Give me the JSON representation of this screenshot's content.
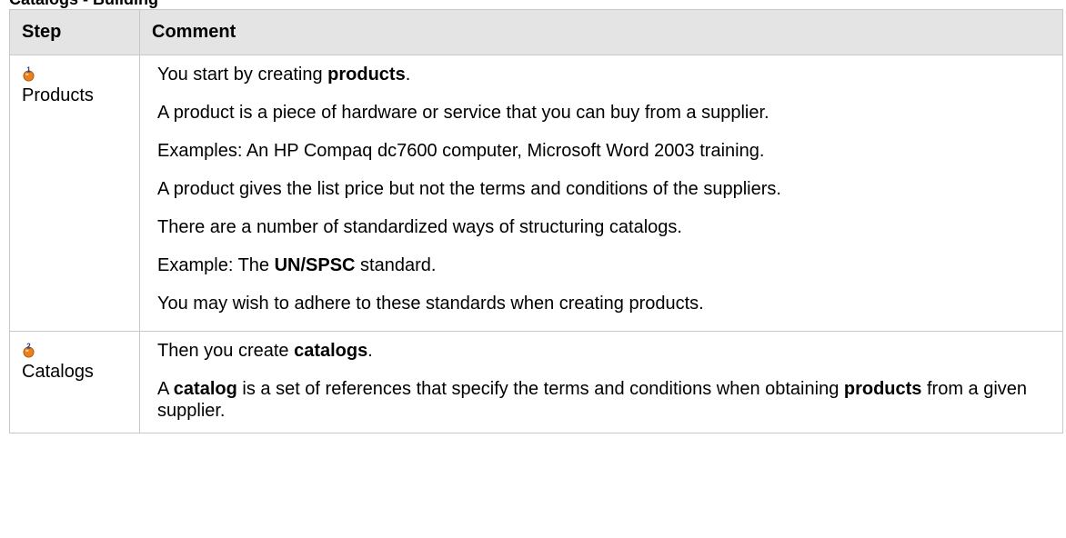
{
  "caption": "Catalogs - Building",
  "table": {
    "headers": {
      "step": "Step",
      "comment": "Comment"
    },
    "rows": [
      {
        "step_number": "1",
        "step_label": "Products",
        "icon": "step-1-icon",
        "paragraphs": [
          {
            "pre": "You start by creating ",
            "bold": "products",
            "post": "."
          },
          {
            "text": "A product is a piece of hardware or service that you can buy from a supplier."
          },
          {
            "text": "Examples: An HP Compaq dc7600 computer, Microsoft Word 2003 training."
          },
          {
            "text": "A product gives the list price but not the terms and conditions of the suppliers."
          },
          {
            "text": "There are a number of standardized ways of structuring catalogs."
          },
          {
            "pre": "Example: The ",
            "bold": "UN/SPSC",
            "post": " standard."
          },
          {
            "text": "You may wish to adhere to these standards when creating products."
          }
        ]
      },
      {
        "step_number": "2",
        "step_label": "Catalogs",
        "icon": "step-2-icon",
        "paragraphs": [
          {
            "pre": "Then you create ",
            "bold": "catalogs",
            "post": "."
          },
          {
            "pre": "A ",
            "bold": "catalog",
            "mid": " is a set of references that specify the terms and conditions when obtaining ",
            "bold2": "products",
            "post": " from a given supplier."
          }
        ]
      }
    ]
  },
  "colors": {
    "header_bg": "#e4e4e4",
    "border": "#c8c8c8",
    "icon_orange": "#e8801c",
    "icon_number_blue": "#1a3c8c"
  }
}
